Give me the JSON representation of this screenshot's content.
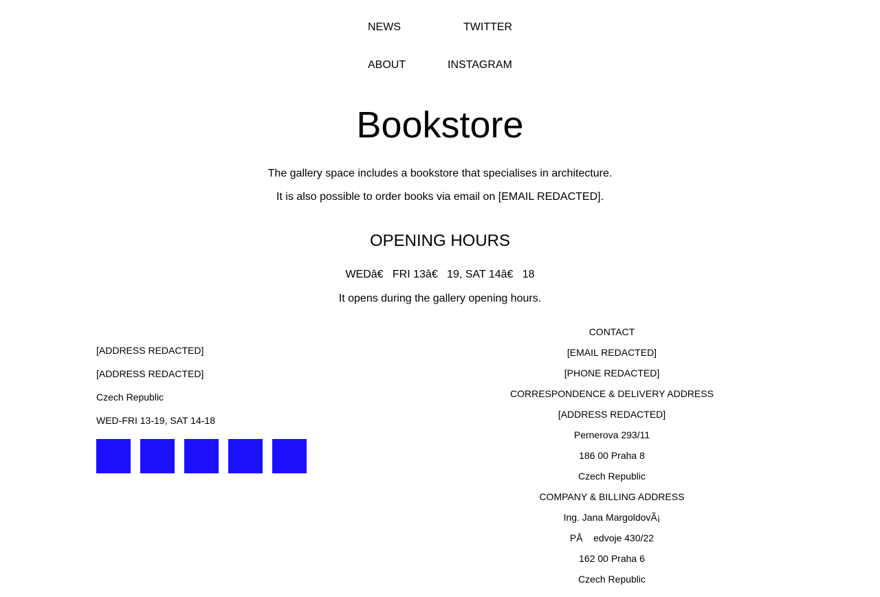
{
  "nav": {
    "news": "NEWS",
    "twitter": "TWITTER",
    "about": "ABOUT",
    "instagram": "INSTAGRAM"
  },
  "main": {
    "title": "Bookstore",
    "intro_1": "The gallery space includes a bookstore that specialises in architecture.",
    "intro_2": "It is also possible to order books via email on [EMAIL REDACTED].",
    "hours_heading": "OPENING HOURS",
    "hours_line": "WEDâ€   FRI 13â€   19, SAT 14â€   18",
    "hours_note": "It opens during the gallery opening hours."
  },
  "footer_left": {
    "address_1": "[ADDRESS REDACTED]",
    "address_2": "[ADDRESS REDACTED]",
    "country": "Czech Republic",
    "hours": "WED-FRI 13-19, SAT 14-18",
    "social_count": 5,
    "social_color": "#1b12fb"
  },
  "footer_right": {
    "contact_label": "CONTACT",
    "email": "[EMAIL REDACTED]",
    "phone": "[PHONE REDACTED]",
    "correspondence_label": "CORRESPONDENCE & DELIVERY ADDRESS",
    "correspondence_address": "[ADDRESS REDACTED]",
    "correspondence_street": "Pernerova 293/11",
    "correspondence_city": "186 00 Praha 8",
    "correspondence_country": "Czech Republic",
    "billing_label": "COMPANY & BILLING ADDRESS",
    "billing_name": "Ing. Jana MargoldovÃ¡",
    "billing_street": "PÅ    edvoje 430/22",
    "billing_city": "162 00 Praha 6",
    "billing_country": "Czech Republic"
  }
}
